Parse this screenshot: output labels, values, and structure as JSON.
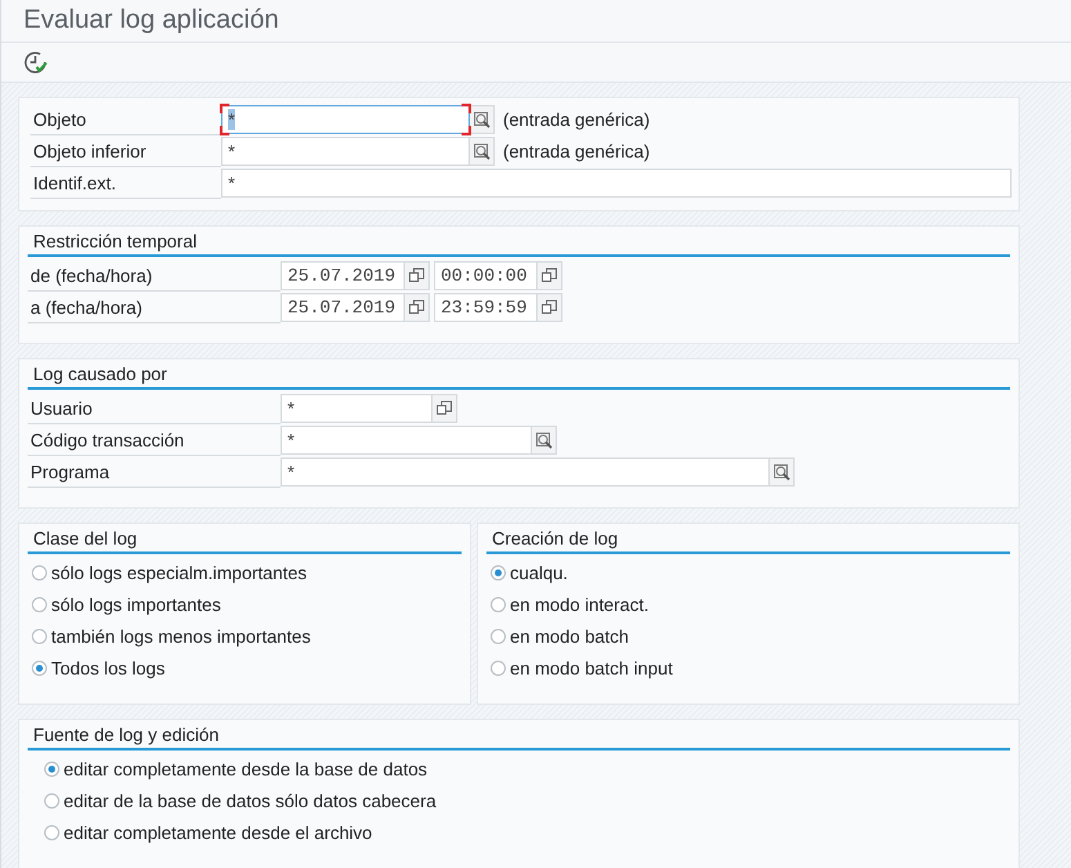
{
  "window": {
    "title": "Evaluar log aplicación"
  },
  "toolbar": {
    "buttons": [
      {
        "kind": "execute"
      }
    ]
  },
  "object_section": {
    "rows": [
      {
        "kind": "search",
        "label": "Objeto",
        "value": "*",
        "focused": true,
        "note": "(entrada genérica)"
      },
      {
        "kind": "search",
        "label": "Objeto inferior",
        "value": "*",
        "focused": false,
        "note": "(entrada genérica)"
      },
      {
        "kind": "plain",
        "label": "Identif.ext.",
        "value": "*",
        "focused": false
      }
    ]
  },
  "time_section": {
    "title": "Restricción temporal",
    "rows": [
      {
        "label": "de (fecha/hora)",
        "date": "25.07.2019",
        "time": "00:00:00"
      },
      {
        "label": "a (fecha/hora)",
        "date": "25.07.2019",
        "time": "23:59:59"
      }
    ]
  },
  "caused_by_section": {
    "title": "Log causado por",
    "rows": [
      {
        "kind": "list",
        "label": "Usuario",
        "value": "*"
      },
      {
        "kind": "search",
        "label": "Código transacción",
        "value": "*"
      },
      {
        "kind": "search",
        "label": "Programa",
        "value": "*"
      }
    ]
  },
  "log_class_section": {
    "title": "Clase del log",
    "options": [
      {
        "label": "sólo logs especialm.importantes",
        "selected": false
      },
      {
        "label": "sólo logs importantes",
        "selected": false
      },
      {
        "label": "también logs menos importantes",
        "selected": false
      },
      {
        "label": "Todos los logs",
        "selected": true
      }
    ]
  },
  "creation_section": {
    "title": "Creación de log",
    "options": [
      {
        "label": "cualqu.",
        "selected": true
      },
      {
        "label": "en modo interact.",
        "selected": false
      },
      {
        "label": "en modo batch",
        "selected": false
      },
      {
        "label": "en modo batch input",
        "selected": false
      }
    ]
  },
  "source_section": {
    "title": "Fuente de log y edición",
    "options": [
      {
        "label": "editar completamente desde la base de datos",
        "selected": true
      },
      {
        "label": "editar de la base de datos sólo datos cabecera",
        "selected": false
      },
      {
        "label": "editar completamente desde el archivo",
        "selected": false
      }
    ]
  }
}
